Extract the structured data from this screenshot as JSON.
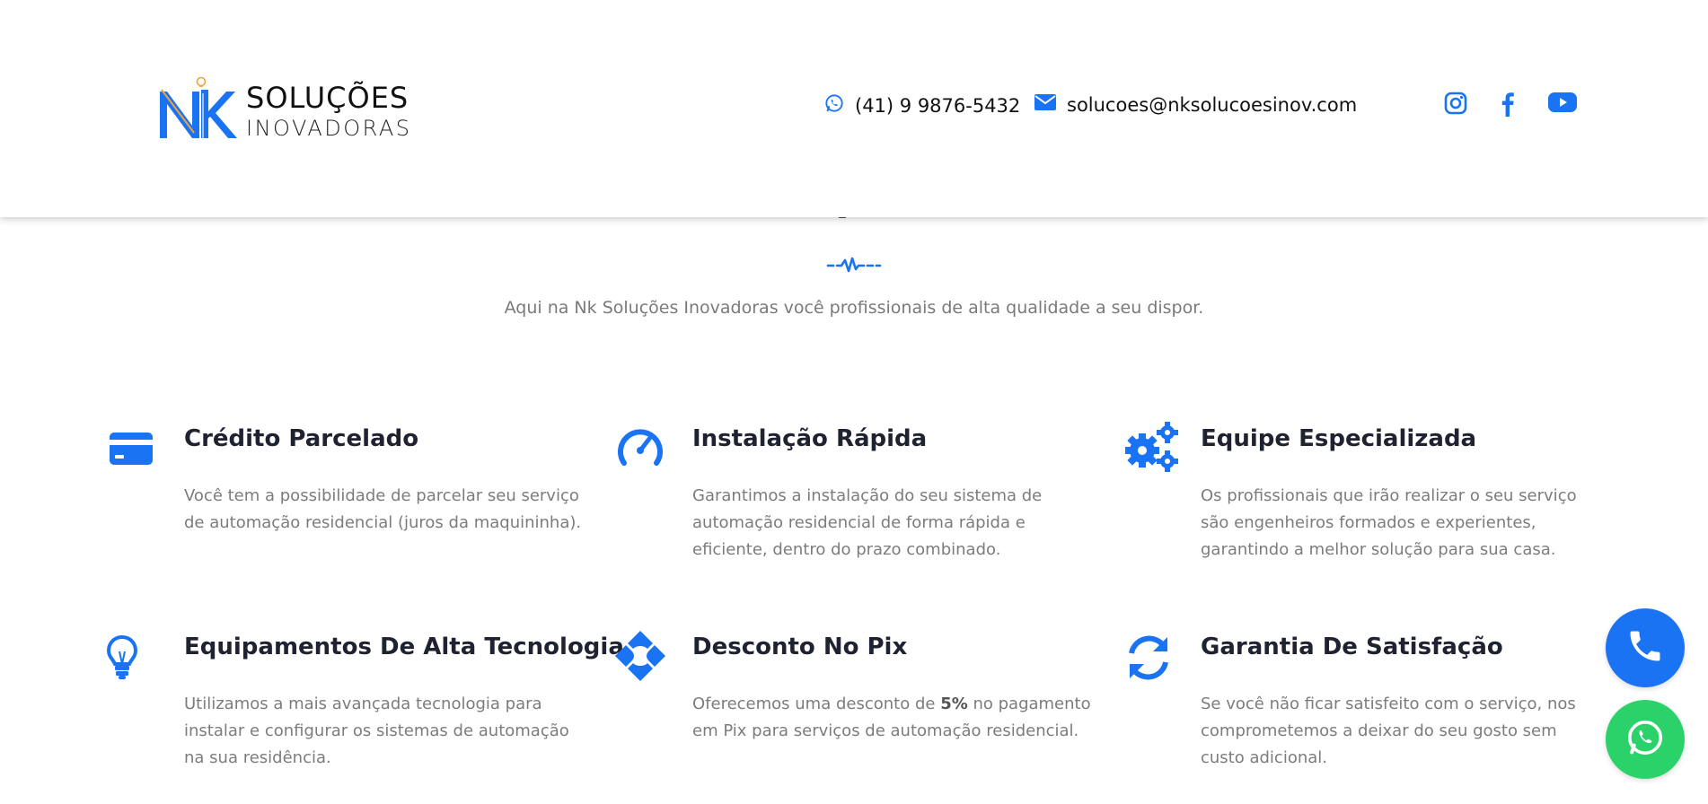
{
  "header": {
    "logo_line1": "SOLUÇÕES",
    "logo_line2": "INOVADORAS",
    "phone": "(41) 9 9876-5432",
    "email": "solucoes@nksolucoesinov.com",
    "socials": [
      "instagram-icon",
      "facebook-icon",
      "youtube-icon"
    ]
  },
  "intro": {
    "subtitle": "Aqui na Nk Soluções Inovadoras você profissionais de alta qualidade a seu dispor."
  },
  "features": [
    {
      "icon": "credit-card-icon",
      "title": "Crédito Parcelado",
      "text": "Você tem a possibilidade de parcelar seu serviço de automação residencial (juros da maquininha)."
    },
    {
      "icon": "speedometer-icon",
      "title": "Instalação Rápida",
      "text": "Garantimos a instalação do seu sistema de automação residencial de forma rápida e eficiente, dentro do prazo combinado."
    },
    {
      "icon": "gears-icon",
      "title": "Equipe Especializada",
      "text": "Os profissionais que irão realizar o seu serviço são engenheiros formados e experientes, garantindo a melhor solução para sua casa."
    },
    {
      "icon": "lightbulb-icon",
      "title": "Equipamentos De Alta Tecnologia",
      "text": "Utilizamos a mais avançada tecnologia para instalar e configurar os sistemas de automação na sua residência."
    },
    {
      "icon": "pix-icon",
      "title": "Desconto No Pix",
      "text_before": "Oferecemos uma desconto de ",
      "text_bold": "5%",
      "text_after": " no pagamento em Pix para serviços de automação residencial."
    },
    {
      "icon": "sync-icon",
      "title": "Garantia De Satisfação",
      "text": "Se você não ficar satisfeito com o serviço, nos comprometemos a deixar do seu gosto sem custo adicional."
    }
  ],
  "floating": [
    "phone-call-icon",
    "whatsapp-icon"
  ],
  "colors": {
    "accent": "#1a73f2",
    "heading": "#1f2230",
    "body_text": "#7c7c7c",
    "whatsapp": "#2bd26a",
    "logo_orange": "#f0a23b"
  }
}
